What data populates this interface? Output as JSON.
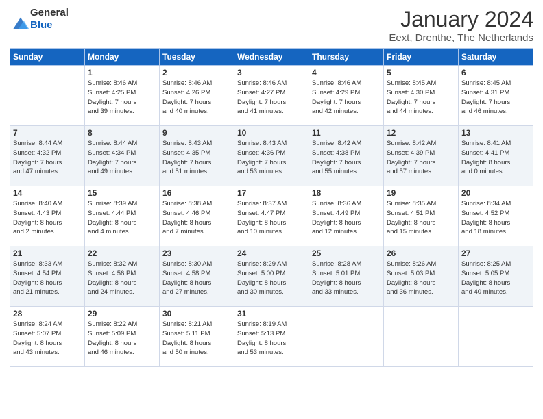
{
  "header": {
    "logo_general": "General",
    "logo_blue": "Blue",
    "month_year": "January 2024",
    "location": "Eext, Drenthe, The Netherlands"
  },
  "days_of_week": [
    "Sunday",
    "Monday",
    "Tuesday",
    "Wednesday",
    "Thursday",
    "Friday",
    "Saturday"
  ],
  "weeks": [
    [
      {
        "day": "",
        "content": ""
      },
      {
        "day": "1",
        "content": "Sunrise: 8:46 AM\nSunset: 4:25 PM\nDaylight: 7 hours\nand 39 minutes."
      },
      {
        "day": "2",
        "content": "Sunrise: 8:46 AM\nSunset: 4:26 PM\nDaylight: 7 hours\nand 40 minutes."
      },
      {
        "day": "3",
        "content": "Sunrise: 8:46 AM\nSunset: 4:27 PM\nDaylight: 7 hours\nand 41 minutes."
      },
      {
        "day": "4",
        "content": "Sunrise: 8:46 AM\nSunset: 4:29 PM\nDaylight: 7 hours\nand 42 minutes."
      },
      {
        "day": "5",
        "content": "Sunrise: 8:45 AM\nSunset: 4:30 PM\nDaylight: 7 hours\nand 44 minutes."
      },
      {
        "day": "6",
        "content": "Sunrise: 8:45 AM\nSunset: 4:31 PM\nDaylight: 7 hours\nand 46 minutes."
      }
    ],
    [
      {
        "day": "7",
        "content": "Sunrise: 8:44 AM\nSunset: 4:32 PM\nDaylight: 7 hours\nand 47 minutes."
      },
      {
        "day": "8",
        "content": "Sunrise: 8:44 AM\nSunset: 4:34 PM\nDaylight: 7 hours\nand 49 minutes."
      },
      {
        "day": "9",
        "content": "Sunrise: 8:43 AM\nSunset: 4:35 PM\nDaylight: 7 hours\nand 51 minutes."
      },
      {
        "day": "10",
        "content": "Sunrise: 8:43 AM\nSunset: 4:36 PM\nDaylight: 7 hours\nand 53 minutes."
      },
      {
        "day": "11",
        "content": "Sunrise: 8:42 AM\nSunset: 4:38 PM\nDaylight: 7 hours\nand 55 minutes."
      },
      {
        "day": "12",
        "content": "Sunrise: 8:42 AM\nSunset: 4:39 PM\nDaylight: 7 hours\nand 57 minutes."
      },
      {
        "day": "13",
        "content": "Sunrise: 8:41 AM\nSunset: 4:41 PM\nDaylight: 8 hours\nand 0 minutes."
      }
    ],
    [
      {
        "day": "14",
        "content": "Sunrise: 8:40 AM\nSunset: 4:43 PM\nDaylight: 8 hours\nand 2 minutes."
      },
      {
        "day": "15",
        "content": "Sunrise: 8:39 AM\nSunset: 4:44 PM\nDaylight: 8 hours\nand 4 minutes."
      },
      {
        "day": "16",
        "content": "Sunrise: 8:38 AM\nSunset: 4:46 PM\nDaylight: 8 hours\nand 7 minutes."
      },
      {
        "day": "17",
        "content": "Sunrise: 8:37 AM\nSunset: 4:47 PM\nDaylight: 8 hours\nand 10 minutes."
      },
      {
        "day": "18",
        "content": "Sunrise: 8:36 AM\nSunset: 4:49 PM\nDaylight: 8 hours\nand 12 minutes."
      },
      {
        "day": "19",
        "content": "Sunrise: 8:35 AM\nSunset: 4:51 PM\nDaylight: 8 hours\nand 15 minutes."
      },
      {
        "day": "20",
        "content": "Sunrise: 8:34 AM\nSunset: 4:52 PM\nDaylight: 8 hours\nand 18 minutes."
      }
    ],
    [
      {
        "day": "21",
        "content": "Sunrise: 8:33 AM\nSunset: 4:54 PM\nDaylight: 8 hours\nand 21 minutes."
      },
      {
        "day": "22",
        "content": "Sunrise: 8:32 AM\nSunset: 4:56 PM\nDaylight: 8 hours\nand 24 minutes."
      },
      {
        "day": "23",
        "content": "Sunrise: 8:30 AM\nSunset: 4:58 PM\nDaylight: 8 hours\nand 27 minutes."
      },
      {
        "day": "24",
        "content": "Sunrise: 8:29 AM\nSunset: 5:00 PM\nDaylight: 8 hours\nand 30 minutes."
      },
      {
        "day": "25",
        "content": "Sunrise: 8:28 AM\nSunset: 5:01 PM\nDaylight: 8 hours\nand 33 minutes."
      },
      {
        "day": "26",
        "content": "Sunrise: 8:26 AM\nSunset: 5:03 PM\nDaylight: 8 hours\nand 36 minutes."
      },
      {
        "day": "27",
        "content": "Sunrise: 8:25 AM\nSunset: 5:05 PM\nDaylight: 8 hours\nand 40 minutes."
      }
    ],
    [
      {
        "day": "28",
        "content": "Sunrise: 8:24 AM\nSunset: 5:07 PM\nDaylight: 8 hours\nand 43 minutes."
      },
      {
        "day": "29",
        "content": "Sunrise: 8:22 AM\nSunset: 5:09 PM\nDaylight: 8 hours\nand 46 minutes."
      },
      {
        "day": "30",
        "content": "Sunrise: 8:21 AM\nSunset: 5:11 PM\nDaylight: 8 hours\nand 50 minutes."
      },
      {
        "day": "31",
        "content": "Sunrise: 8:19 AM\nSunset: 5:13 PM\nDaylight: 8 hours\nand 53 minutes."
      },
      {
        "day": "",
        "content": ""
      },
      {
        "day": "",
        "content": ""
      },
      {
        "day": "",
        "content": ""
      }
    ]
  ]
}
